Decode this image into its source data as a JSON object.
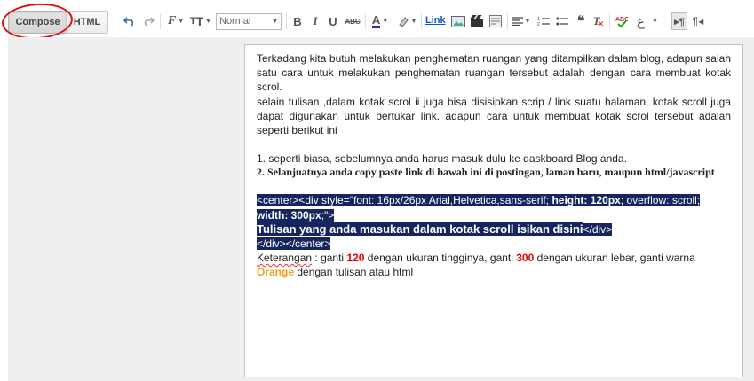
{
  "toolbar": {
    "compose_label": "Compose",
    "html_label": "HTML",
    "format_value": "Normal",
    "link_label": "Link"
  },
  "editor": {
    "p1": "Terkadang kita butuh melakukan penghematan ruangan yang ditampilkan dalam blog, adapun salah satu cara untuk melakukan penghematan ruangan tersebut adalah dengan cara membuat kotak scrol.",
    "p2": "selain tulisan ,dalam kotak scrol ii juga bisa disisipkan scrip / link suatu halaman. kotak scroll juga  dapat digunakan untuk bertukar link. adapun cara untuk membuat kotak scrol tersebut adalah seperti berikut ini",
    "step1": "1. seperti biasa, sebelumnya anda harus masuk dulu ke daskboard Blog anda.",
    "step2": " 2. Selanjuatnya anda copy paste  link di bawah ini di postingan, laman baru, maupun html/javascript",
    "code_a": "<center><div style=\"font: 16px/26px Arial,Helvetica,sans-serif; ",
    "code_b": "height: 120px",
    "code_c": "; overflow: scroll; ",
    "code_d": "width: 300px",
    "code_e": ";\">",
    "code_f": "Tulisan yang anda masukan dalam kotak scroll isikan disini",
    "code_g": "</div>",
    "code_h": "</div></center>",
    "note_a": "Keterangan",
    "note_b": " : ganti ",
    "note_120": "120",
    "note_c": " dengan ukuran tingginya, ganti ",
    "note_300": "300",
    "note_d": " dengan ukuran lebar, ganti warna ",
    "note_orange": "Orange",
    "note_e": " dengan tulisan atau html"
  },
  "colors": {
    "selection": "#16255f",
    "highlight_red": "#e00000",
    "highlight_orange": "#f0a020",
    "annotation_circle": "#e01010"
  }
}
